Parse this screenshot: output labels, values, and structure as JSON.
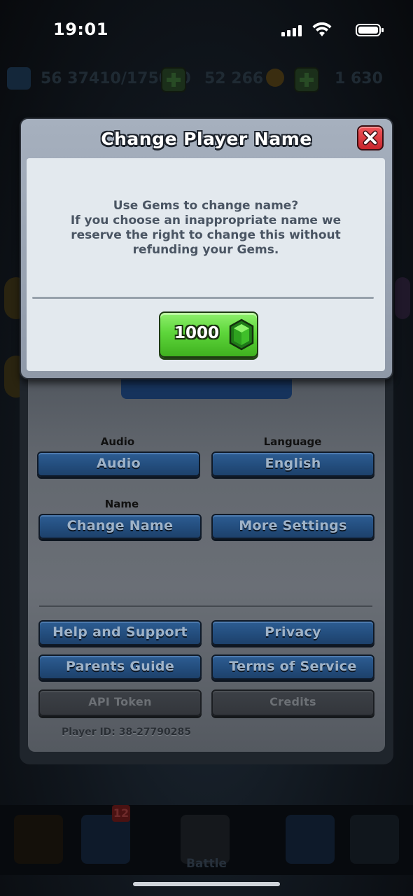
{
  "status_bar": {
    "time": "19:01"
  },
  "background": {
    "xp": "56 37410/175000",
    "gold": "52 266",
    "gems": "1 630",
    "nav_badge": "12",
    "nav_battle": "Battle"
  },
  "modal": {
    "title": "Change Player Name",
    "text_lines": [
      "Use Gems to change name?",
      "If you choose an inappropriate name we",
      "reserve the right to change this without",
      "refunding your Gems."
    ],
    "gem_button_label": "1000",
    "close_icon": "close-icon"
  },
  "settings": {
    "audio_label": "Audio",
    "audio_button": "Audio",
    "language_label": "Language",
    "language_button": "English",
    "name_label": "Name",
    "change_name_button": "Change Name",
    "more_settings_button": "More Settings",
    "help_button": "Help and Support",
    "privacy_button": "Privacy",
    "parents_button": "Parents Guide",
    "terms_button": "Terms of Service",
    "api_button": "API Token",
    "credits_button": "Credits",
    "player_id": "Player ID: 38-27790285"
  },
  "colors": {
    "accent_blue": "#234d7d",
    "gem_green": "#5ed63b",
    "close_red": "#c9262d",
    "modal_body": "#e3e9ee"
  }
}
